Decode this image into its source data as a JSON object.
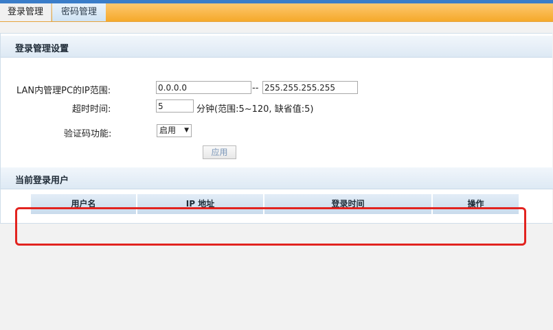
{
  "tabs": [
    {
      "label": "登录管理"
    },
    {
      "label": "密码管理"
    }
  ],
  "login_settings": {
    "title": "登录管理设置",
    "lan_range_label": "LAN内管理PC的IP范围:",
    "ip_start": "0.0.0.0",
    "range_separator": "--",
    "ip_end": "255.255.255.255",
    "timeout_label": "超时时间:",
    "timeout_value": "5",
    "timeout_hint": "分钟(范围:5~120, 缺省值:5)",
    "captcha_label": "验证码功能:",
    "captcha_value": "启用",
    "apply_label": "应用"
  },
  "current_users": {
    "title": "当前登录用户",
    "columns": [
      "用户名",
      "IP 地址",
      "登录时间",
      "操作"
    ]
  },
  "colors": {
    "tabbar": "#f5a92a",
    "highlight": "#e2231f",
    "header_bg": "#dde9f4"
  }
}
